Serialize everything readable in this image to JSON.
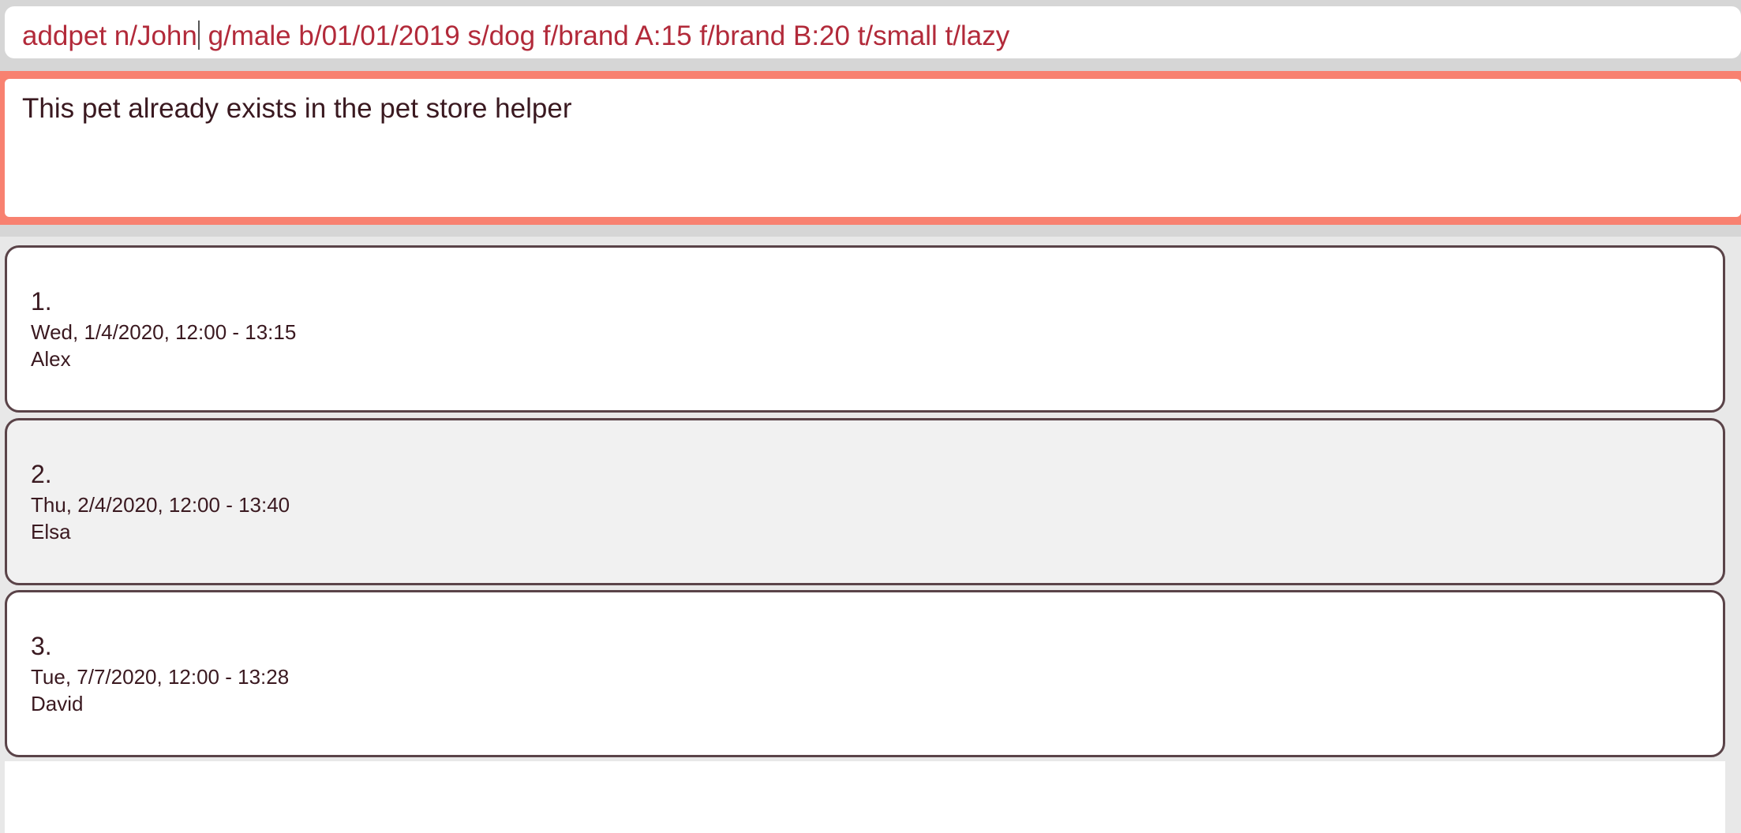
{
  "command": {
    "text_before_cursor": "addpet n/John",
    "text_after_cursor": " g/male b/01/01/2019 s/dog f/brand A:15 f/brand B:20 t/small t/lazy"
  },
  "result": {
    "message": "This pet already exists in the pet store helper"
  },
  "schedule": {
    "items": [
      {
        "index": "1.",
        "datetime": "Wed, 1/4/2020, 12:00 - 13:15",
        "name": "Alex"
      },
      {
        "index": "2.",
        "datetime": "Thu, 2/4/2020, 12:00 - 13:40",
        "name": "Elsa"
      },
      {
        "index": "3.",
        "datetime": "Tue, 7/7/2020, 12:00 - 13:28",
        "name": "David"
      }
    ]
  }
}
